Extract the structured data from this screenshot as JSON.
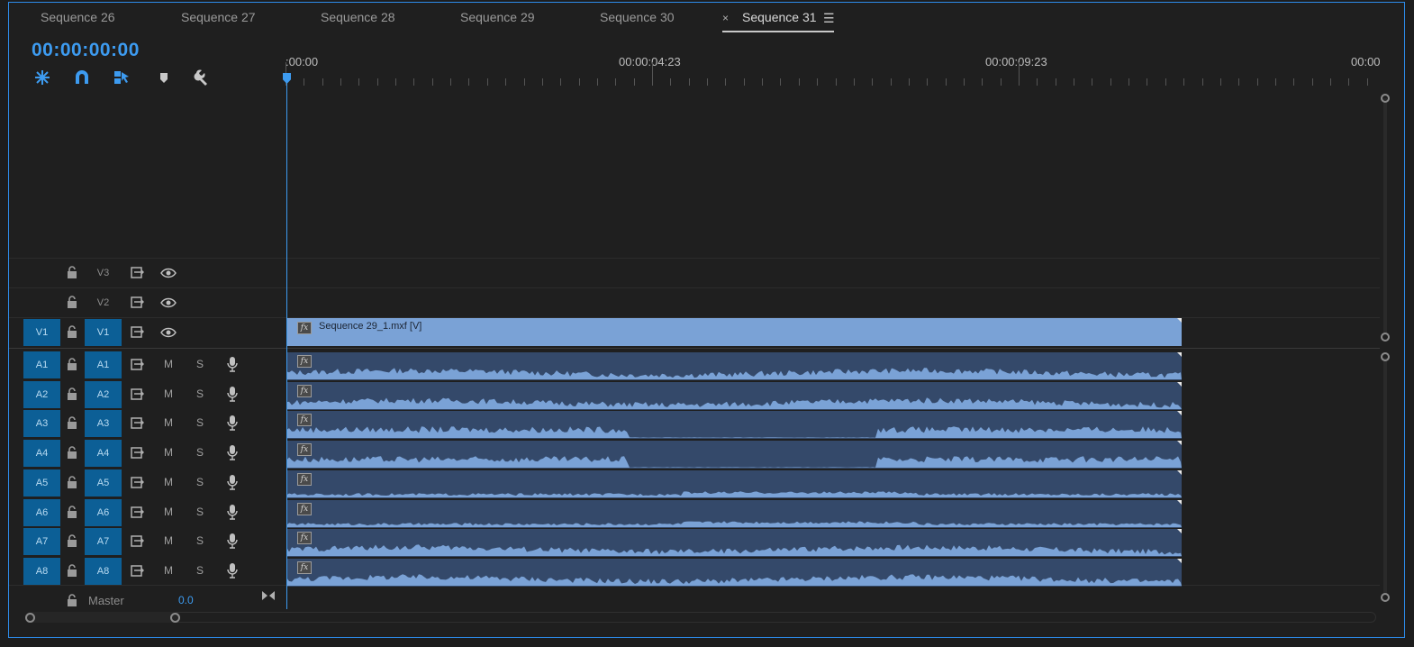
{
  "tabs": [
    {
      "label": "Sequence 26"
    },
    {
      "label": "Sequence 27"
    },
    {
      "label": "Sequence 28"
    },
    {
      "label": "Sequence 29"
    },
    {
      "label": "Sequence 30"
    },
    {
      "label": "Sequence 31",
      "active": true
    }
  ],
  "tab_close_glyph": "×",
  "tab_menu_glyph": "☰",
  "timecode": "00:00:00:00",
  "toolbar": {
    "icons": [
      "nest-sequence-icon",
      "snap-magnet-icon",
      "linked-selection-icon",
      "add-marker-icon",
      "settings-wrench-icon"
    ]
  },
  "ruler": {
    "labels": [
      ":00:00",
      "00:00:04:23",
      "00:00:09:23",
      "00:00"
    ]
  },
  "video_tracks": [
    {
      "label": "V3",
      "source_patch": "",
      "targeted": false
    },
    {
      "label": "V2",
      "source_patch": "",
      "targeted": false
    },
    {
      "label": "V1",
      "source_patch": "V1",
      "targeted": true
    }
  ],
  "audio_tracks": [
    {
      "label": "A1",
      "source_patch": "A1",
      "mute": "M",
      "solo": "S"
    },
    {
      "label": "A2",
      "source_patch": "A2",
      "mute": "M",
      "solo": "S"
    },
    {
      "label": "A3",
      "source_patch": "A3",
      "mute": "M",
      "solo": "S"
    },
    {
      "label": "A4",
      "source_patch": "A4",
      "mute": "M",
      "solo": "S"
    },
    {
      "label": "A5",
      "source_patch": "A5",
      "mute": "M",
      "solo": "S"
    },
    {
      "label": "A6",
      "source_patch": "A6",
      "mute": "M",
      "solo": "S"
    },
    {
      "label": "A7",
      "source_patch": "A7",
      "mute": "M",
      "solo": "S"
    },
    {
      "label": "A8",
      "source_patch": "A8",
      "mute": "M",
      "solo": "S"
    }
  ],
  "video_clip": {
    "label": "Sequence 29_1.mxf [V]",
    "fx": "fx"
  },
  "audio_clip_fx": "fx",
  "master": {
    "label": "Master",
    "volume": "0.0"
  },
  "colors": {
    "accent": "#3d9bf0",
    "video_clip": "#7aa2d6",
    "audio_clip": "#34496a",
    "waveform": "#7aa2d6",
    "patch": "#0c5f96"
  }
}
